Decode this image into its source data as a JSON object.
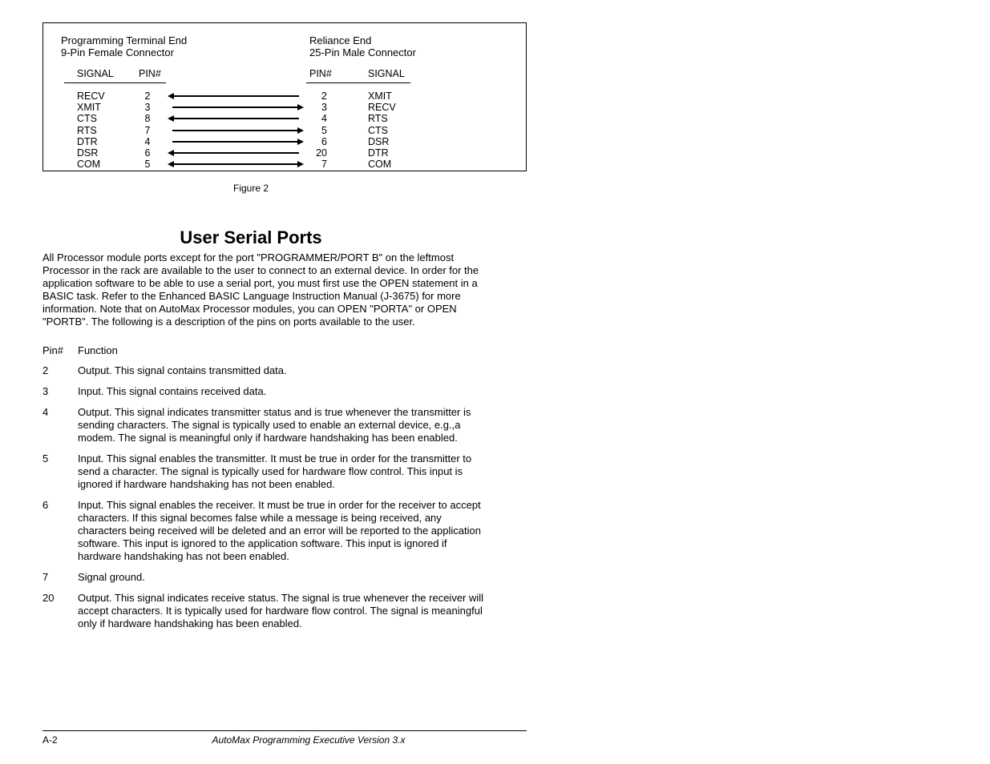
{
  "diagram": {
    "left_header1": "Programming Terminal End",
    "left_header2": "9-Pin Female Connector",
    "right_header1": "Reliance End",
    "right_header2": "25-Pin Male Connector",
    "col_signal_l": "SIGNAL",
    "col_pin_l": "PIN#",
    "col_pin_r": "PIN#",
    "col_signal_r": "SIGNAL",
    "rows": [
      {
        "sigl": "RECV",
        "pinl": "2",
        "pinr": "2",
        "sigr": "XMIT",
        "dir": "left"
      },
      {
        "sigl": "XMIT",
        "pinl": "3",
        "pinr": "3",
        "sigr": "RECV",
        "dir": "right"
      },
      {
        "sigl": "CTS",
        "pinl": "8",
        "pinr": "4",
        "sigr": "RTS",
        "dir": "left"
      },
      {
        "sigl": "RTS",
        "pinl": "7",
        "pinr": "5",
        "sigr": "CTS",
        "dir": "right"
      },
      {
        "sigl": "DTR",
        "pinl": "4",
        "pinr": "6",
        "sigr": "DSR",
        "dir": "right"
      },
      {
        "sigl": "DSR",
        "pinl": "6",
        "pinr": "20",
        "sigr": "DTR",
        "dir": "left"
      },
      {
        "sigl": "COM",
        "pinl": "5",
        "pinr": "7",
        "sigr": "COM",
        "dir": "both"
      }
    ]
  },
  "fig_caption": "Figure 2",
  "section_title": "User Serial Ports",
  "paragraph": "All Processor module ports except for the port \"PROGRAMMER/PORT B\" on the leftmost Processor in the rack are available to the user to connect to an external device. In order for the application software to be able to use a serial port, you must first use the OPEN statement in a BASIC task. Refer to the Enhanced BASIC Language Instruction Manual (J-3675) for more information. Note that on AutoMax Processor modules, you can OPEN \"PORTA\" or OPEN \"PORTB\". The following is a description of the pins on ports available to the user.",
  "pin_header_1": "Pin#",
  "pin_header_2": "Function",
  "pins": [
    {
      "n": "2",
      "f": "Output. This signal contains transmitted data."
    },
    {
      "n": "3",
      "f": "Input. This signal contains received data."
    },
    {
      "n": "4",
      "f": "Output. This signal indicates transmitter status and is true whenever the transmitter is sending characters. The signal is typically used to enable an external device, e.g.,a modem. The signal is meaningful only if hardware handshaking has been enabled."
    },
    {
      "n": "5",
      "f": "Input. This signal enables the transmitter. It must be true in order for the transmitter to send a character. The signal is typically used for hardware flow control. This input is ignored if hardware handshaking has not been enabled."
    },
    {
      "n": "6",
      "f": "Input. This signal enables the receiver. It must be true in order for the receiver to accept characters. If this signal becomes false while a message is being received, any characters being received will be deleted and an error will be reported to the application software. This input is ignored to the application software. This input is ignored if hardware handshaking has not been enabled."
    },
    {
      "n": "7",
      "f": "Signal ground."
    },
    {
      "n": "20",
      "f": "Output. This signal indicates receive status. The signal is true whenever the receiver will accept characters. It is typically used for hardware flow control. The signal is meaningful only if hardware handshaking has been enabled."
    }
  ],
  "footer_page": "A-2",
  "footer_title": "AutoMax Programming Executive Version 3.x"
}
